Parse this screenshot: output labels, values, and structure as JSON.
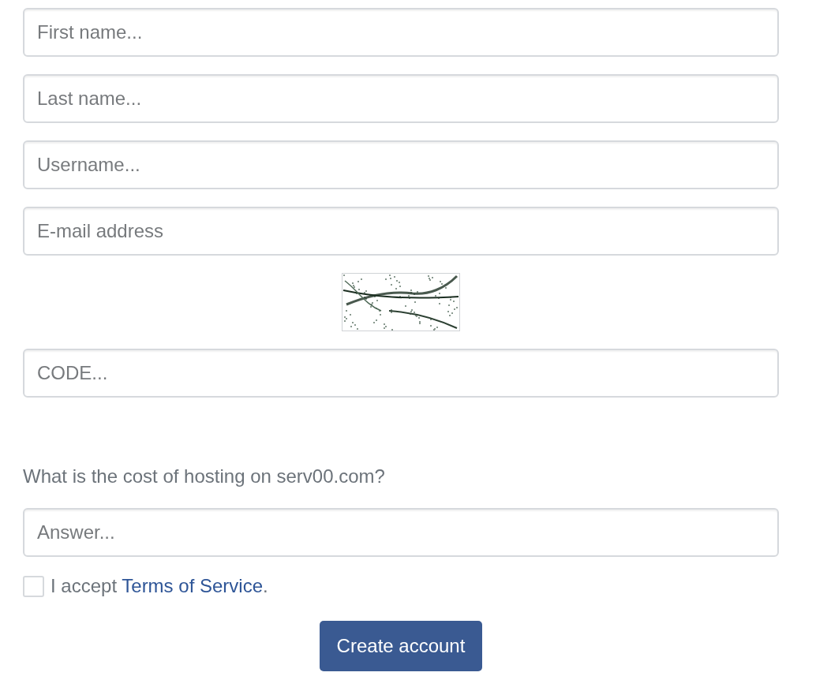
{
  "form": {
    "fields": [
      {
        "placeholder": "First name..."
      },
      {
        "placeholder": "Last name..."
      },
      {
        "placeholder": "Username..."
      },
      {
        "placeholder": "E-mail address"
      }
    ],
    "captcha_field": {
      "placeholder": "CODE..."
    },
    "question": "What is the cost of hosting on serv00.com?",
    "answer_field": {
      "placeholder": "Answer..."
    },
    "terms": {
      "checked": false,
      "text": "I accept ",
      "link": "Terms of Service",
      "suffix": "."
    },
    "submit_button": "Create account"
  }
}
